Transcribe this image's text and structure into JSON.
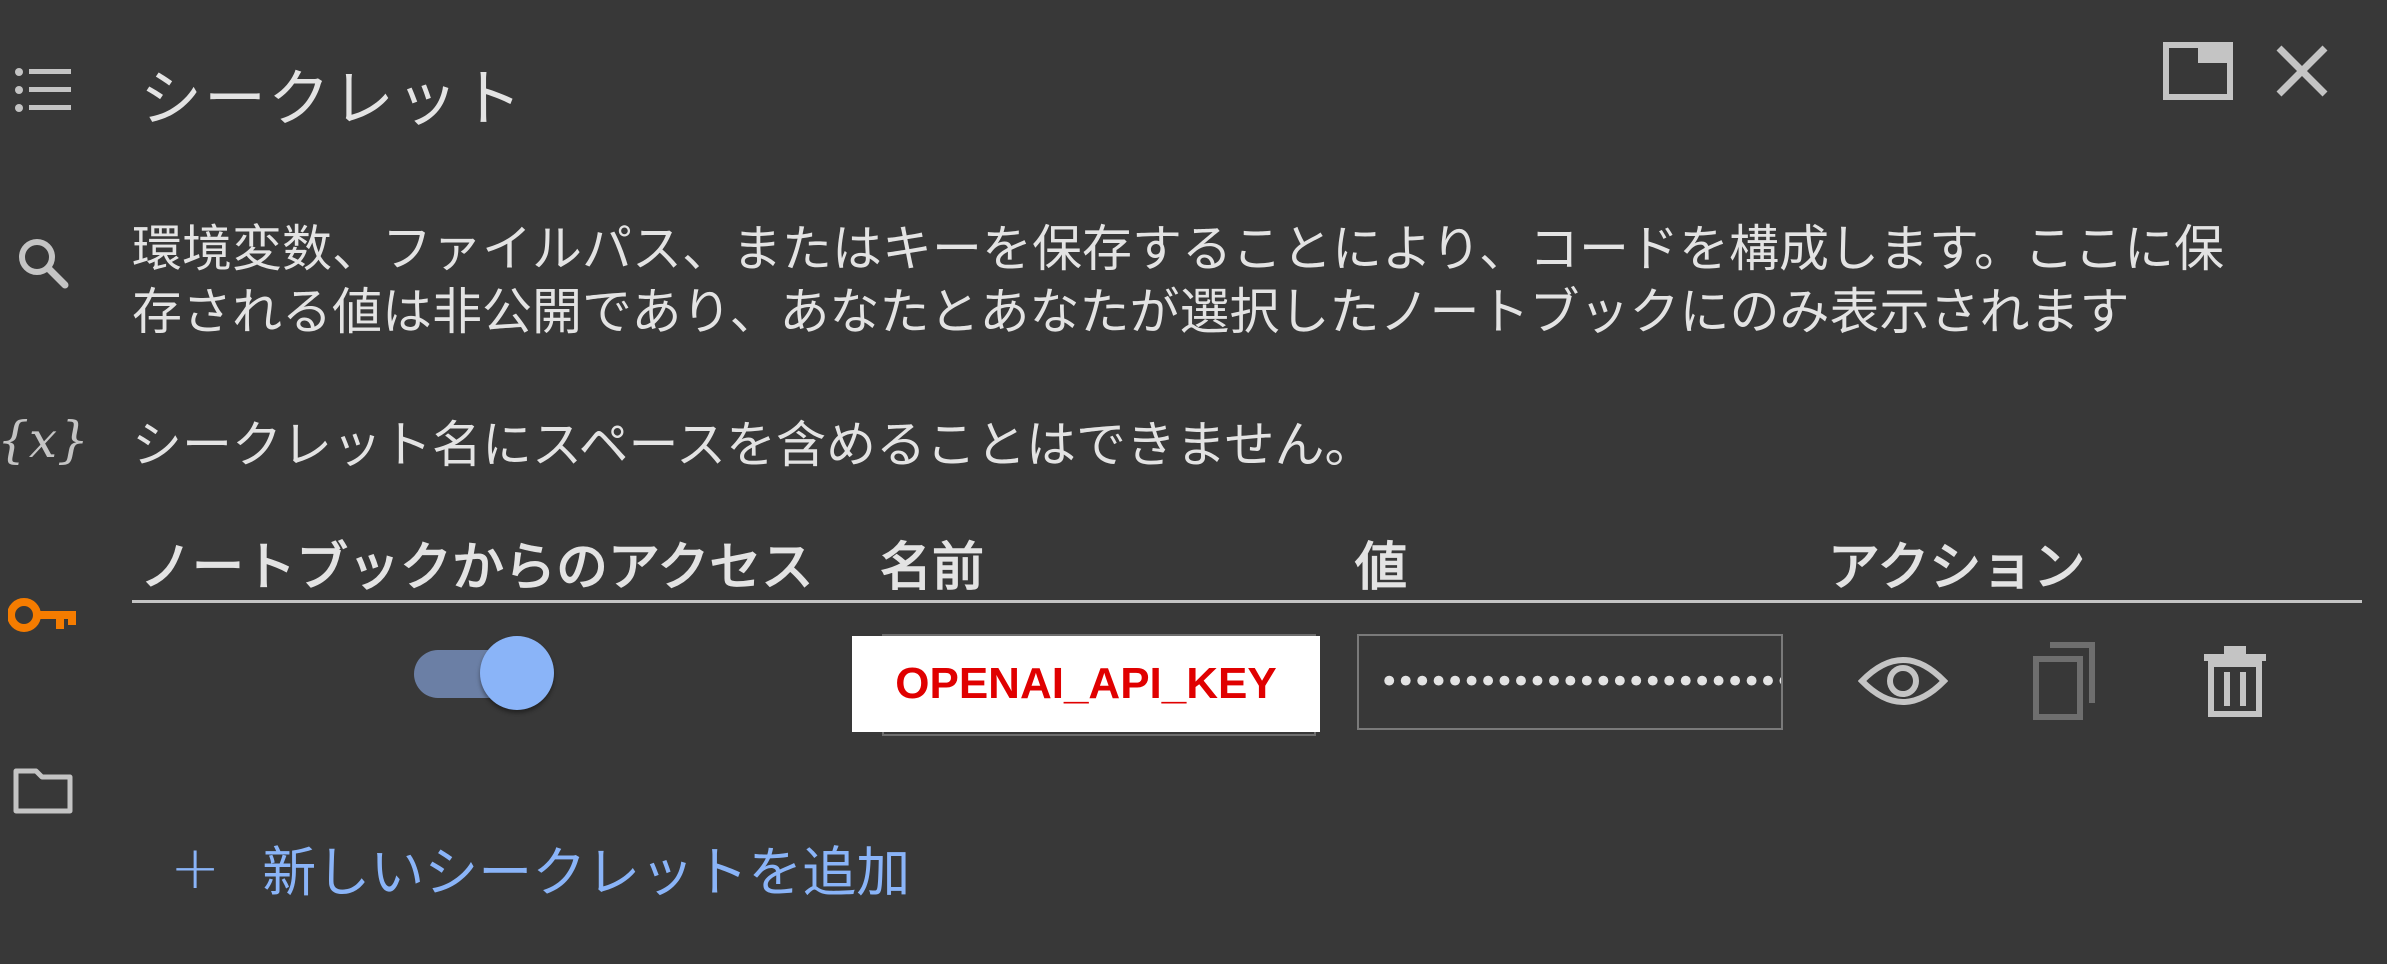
{
  "panel": {
    "title": "シークレット",
    "description_line1": "環境変数、ファイルパス、またはキーを保存することにより、コードを構成します。ここに保",
    "description_line2": "存される値は非公開であり、あなたとあなたが選択したノートブックにのみ表示されます",
    "note": "シークレット名にスペースを含めることはできません。"
  },
  "rail": {
    "icons": [
      "toc-icon",
      "search-icon",
      "variables-icon",
      "key-icon",
      "folder-icon"
    ],
    "variables_label": "{x}",
    "active_color": "#f57c00"
  },
  "table": {
    "headers": {
      "access": "ノートブックからのアクセス",
      "name": "名前",
      "value": "値",
      "actions": "アクション"
    },
    "rows": [
      {
        "access_enabled": true,
        "name": "OPENAI_API_KEY",
        "value_masked": "••••••••••••••••••••••••••"
      }
    ]
  },
  "add_button": {
    "plus": "+",
    "label": "新しいシークレットを追加"
  },
  "colors": {
    "background": "#383838",
    "text": "#e3e3e3",
    "accent": "#8ab4f8",
    "name_text": "#e00000",
    "key_icon": "#f57c00"
  }
}
